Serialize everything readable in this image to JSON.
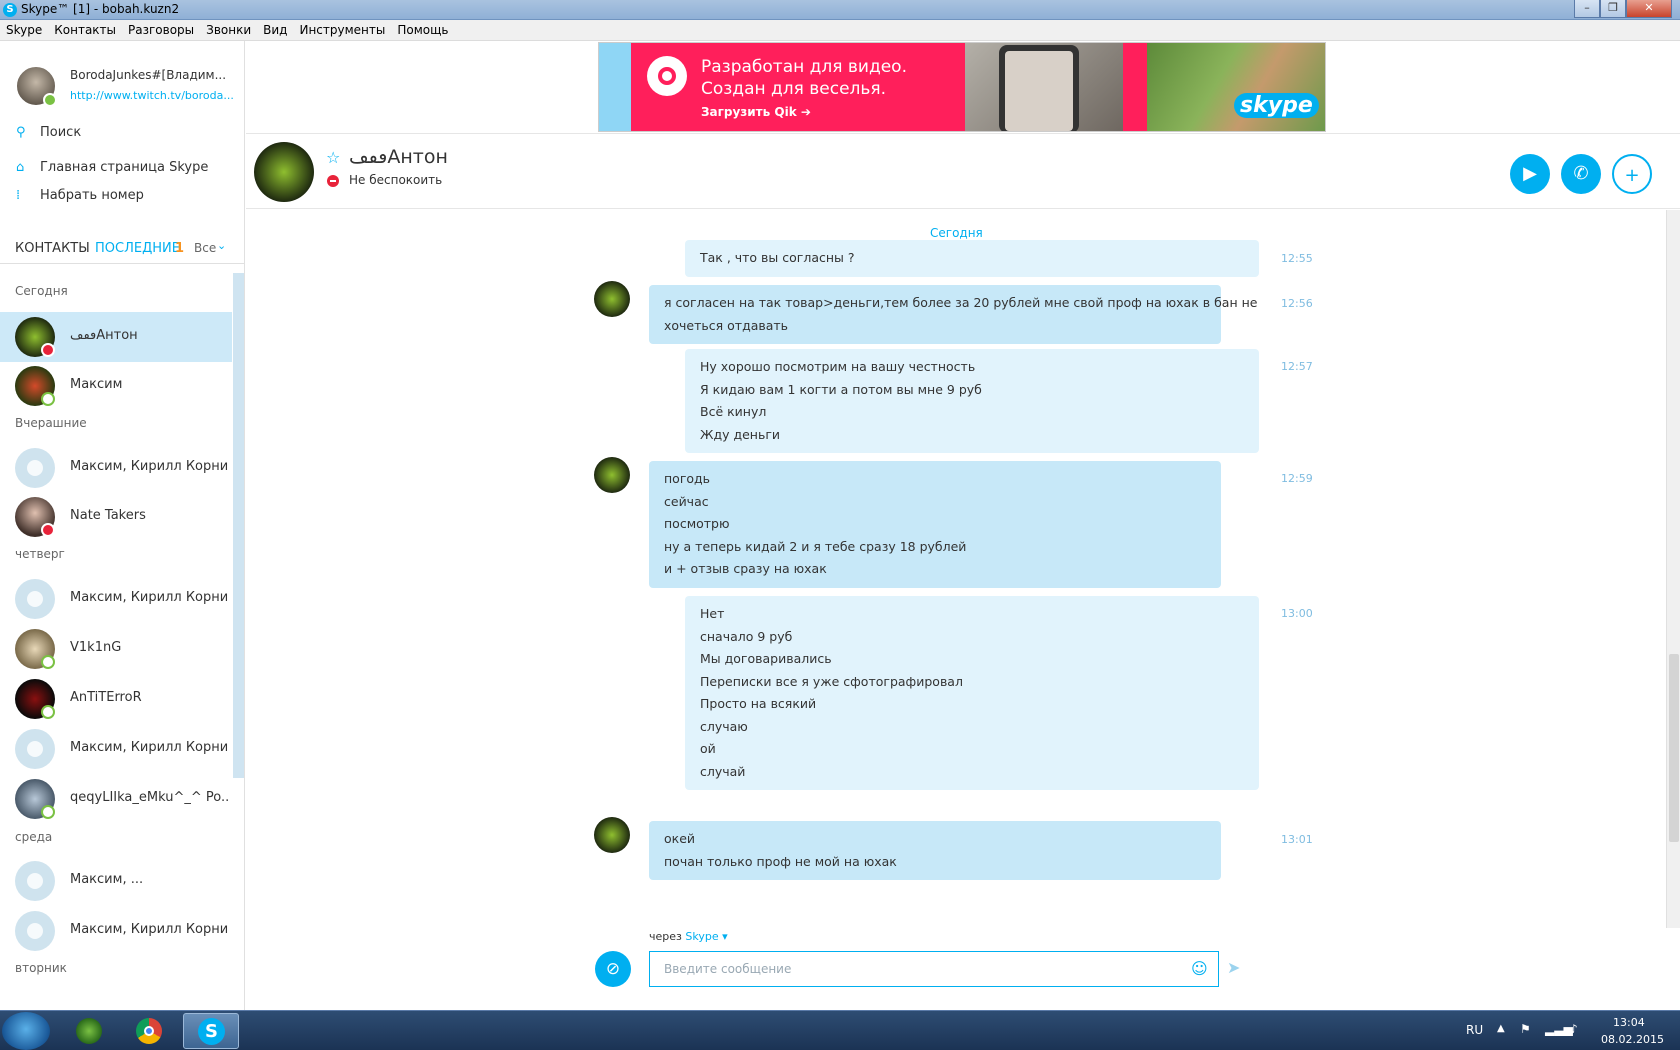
{
  "window": {
    "title": "Skype™ [1] - bobah.kuzn2",
    "app_icon_letter": "S"
  },
  "menu": [
    "Skype",
    "Контакты",
    "Разговоры",
    "Звонки",
    "Вид",
    "Инструменты",
    "Помощь"
  ],
  "profile": {
    "name": "BorodaJunkes#[Владим...",
    "mood_url": "http://www.twitch.tv/boroda...",
    "presence_color": "#7ac143"
  },
  "search": {
    "label": "Поиск"
  },
  "nav": {
    "home": "Главная страница Skype",
    "dial": "Набрать номер"
  },
  "tabs": {
    "contacts": "КОНТАКТЫ",
    "recent": "ПОСЛЕДНИЕ",
    "recent_count": "1",
    "filter": "Все"
  },
  "groups": [
    "Сегодня",
    "Вчерашние",
    "четверг",
    "среда",
    "вторник"
  ],
  "contacts": [
    {
      "name": "ڡڡڡАнтон",
      "status": "dnd"
    },
    {
      "name": "Максим",
      "status": "offline"
    },
    {
      "name": "Максим, Кирилл Корни...",
      "status": "group"
    },
    {
      "name": "Nate Takers",
      "status": "dnd"
    },
    {
      "name": "Максим, Кирилл Корни...",
      "status": "group"
    },
    {
      "name": "V1k1nG",
      "status": "offline"
    },
    {
      "name": "AnTiTErroR",
      "status": "offline"
    },
    {
      "name": "Максим, Кирилл Корни...",
      "status": "group"
    },
    {
      "name": "qeqyLIIka_eMku^_^ Po...",
      "status": "offline"
    },
    {
      "name": "Максим, ...",
      "status": "group"
    },
    {
      "name": "Максим, Кирилл Корни...",
      "status": "group"
    }
  ],
  "ad": {
    "line1": "Разработан для видео.",
    "line2": "Создан для веселья.",
    "cta": "Загрузить Qik ➔",
    "brand": "skype"
  },
  "chat_header": {
    "name": "ڡڡڡАнтон",
    "status": "Не беспокоить"
  },
  "conversation": {
    "day": "Сегодня",
    "messages": [
      {
        "dir": "out",
        "time": "12:55",
        "lines": [
          "Так , что вы согласны ?"
        ]
      },
      {
        "dir": "in",
        "time": "12:56",
        "lines": [
          "я согласен на так товар>деньги,тем более за 20 рублей мне свой проф на юхак в бан не",
          "хочеться отдавать"
        ]
      },
      {
        "dir": "out",
        "time": "12:57",
        "lines": [
          "Ну хорошо посмотрим на вашу честность",
          "Я кидаю вам 1 когти а потом вы мне 9 руб",
          "Всё кинул",
          "Жду деньги"
        ]
      },
      {
        "dir": "in",
        "time": "12:59",
        "lines": [
          "погодь",
          "сейчас",
          "посмотрю",
          "ну а теперь кидай 2 и я тебе сразу 18 рублей",
          "и + отзыв сразу на юхак"
        ]
      },
      {
        "dir": "out",
        "time": "13:00",
        "lines": [
          "Нет",
          "сначало 9 руб",
          "Мы договаривались",
          "Переписки все я уже сфотографировал",
          "Просто на всякий",
          "случаю",
          "ой",
          "случай"
        ]
      },
      {
        "dir": "in",
        "time": "13:01",
        "lines": [
          "окей",
          "почан только проф не мой на юхак"
        ]
      }
    ]
  },
  "composer": {
    "via_prefix": "через",
    "via_service": "Skype",
    "placeholder": "Введите сообщение"
  },
  "tray": {
    "lang": "RU",
    "time": "13:04",
    "date": "08.02.2015"
  },
  "colors": {
    "accent": "#00aff0",
    "incoming_bubble": "#c7e8f8",
    "outgoing_bubble": "#e1f3fc",
    "dnd": "#e8233a"
  }
}
